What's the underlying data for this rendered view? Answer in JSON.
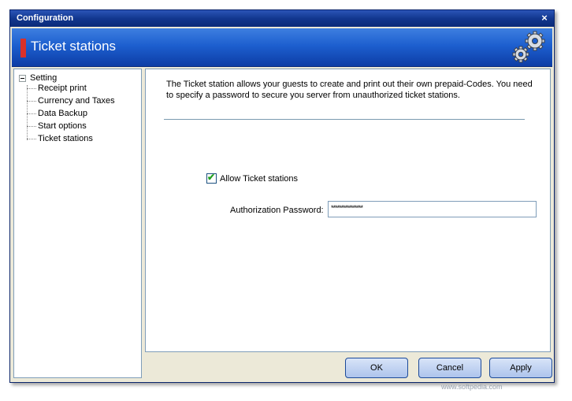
{
  "window": {
    "title": "Configuration",
    "close_glyph": "×"
  },
  "banner": {
    "title": "Ticket stations",
    "icon": "gears-icon"
  },
  "tree": {
    "root": "Setting",
    "items": [
      {
        "label": "Receipt print"
      },
      {
        "label": "Currency and Taxes"
      },
      {
        "label": "Data Backup"
      },
      {
        "label": "Start options"
      },
      {
        "label": "Ticket stations"
      }
    ]
  },
  "content": {
    "description": "The Ticket station allows your guests to create and print out their own prepaid-Codes. You need to specify a password to secure you server from unauthorized ticket stations.",
    "allow_label": "Allow Ticket stations",
    "allow_checked": true,
    "password_label": "Authorization Password:",
    "password_value": "****************"
  },
  "buttons": {
    "ok": "OK",
    "cancel": "Cancel",
    "apply": "Apply"
  },
  "colors": {
    "title_bar": "#12378f",
    "banner": "#1d5fcf",
    "marker": "#d9312a",
    "check": "#21a121"
  },
  "watermark": "www.softpedia.com"
}
